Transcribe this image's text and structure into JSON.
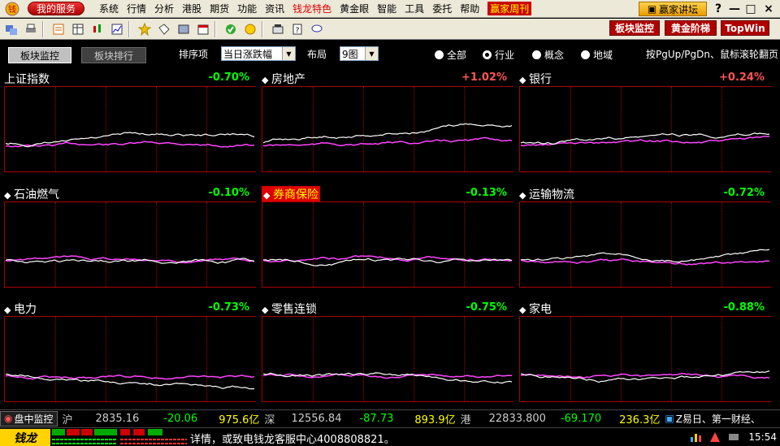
{
  "menu": {
    "service_label": "我的服务",
    "items": [
      "系统",
      "行情",
      "分析",
      "港股",
      "期货",
      "功能",
      "资讯",
      "钱龙特色",
      "黄金眼",
      "智能",
      "工具",
      "委托",
      "帮助",
      "赢家周刊"
    ],
    "forum_label": "赢家讲坛",
    "help": "?",
    "minimize": "—",
    "restore": "□",
    "close": "×"
  },
  "toolbar": {
    "buttons": [
      "板块监控",
      "黄金阶梯",
      "TopWin"
    ]
  },
  "controls": {
    "tab_active": "板块监控",
    "tab_inactive": "板块排行",
    "sort_label": "排序项",
    "sort_value": "当日涨跌幅",
    "layout_label": "布局",
    "layout_value": "9图",
    "radios": [
      "全部",
      "行业",
      "概念",
      "地域"
    ],
    "selected_radio": "行业",
    "hint": "按PgUp/PgDn、鼠标滚轮翻页"
  },
  "panels": [
    {
      "name": "上证指数",
      "change": "-0.70%",
      "color": "#00ff00",
      "marker": false,
      "highlight": false
    },
    {
      "name": "房地产",
      "change": "+1.02%",
      "color": "#ff5555",
      "marker": true,
      "highlight": false
    },
    {
      "name": "银行",
      "change": "+0.24%",
      "color": "#ff5555",
      "marker": true,
      "highlight": false
    },
    {
      "name": "石油燃气",
      "change": "-0.10%",
      "color": "#00ff00",
      "marker": true,
      "highlight": false
    },
    {
      "name": "券商保险",
      "change": "-0.13%",
      "color": "#00ff00",
      "marker": true,
      "highlight": true
    },
    {
      "name": "运输物流",
      "change": "-0.72%",
      "color": "#00ff00",
      "marker": true,
      "highlight": false
    },
    {
      "name": "电力",
      "change": "-0.73%",
      "color": "#00ff00",
      "marker": true,
      "highlight": false
    },
    {
      "name": "零售连锁",
      "change": "-0.75%",
      "color": "#00ff00",
      "marker": true,
      "highlight": false
    },
    {
      "name": "家电",
      "change": "-0.88%",
      "color": "#00ff00",
      "marker": true,
      "highlight": false
    }
  ],
  "status": {
    "monitor_label": "盘中监控",
    "markets": [
      {
        "name": "沪",
        "value": "2835.16",
        "change": "-20.06",
        "volume": "975.6亿"
      },
      {
        "name": "深",
        "value": "12556.84",
        "change": "-87.73",
        "volume": "893.9亿"
      },
      {
        "name": "港",
        "value": "22833.800",
        "change": "-69.170",
        "volume": "236.3亿"
      }
    ],
    "news": "Z易日、第一财经、",
    "brand": "钱龙",
    "ticker": "详情，或致电钱龙客服中心4008808821。",
    "clock": "15:54"
  },
  "colors": {
    "up": "#ff5555",
    "down": "#00ff00",
    "white_line": "#ffffff",
    "magenta_line": "#ff44ff",
    "grid": "#aa0000"
  }
}
